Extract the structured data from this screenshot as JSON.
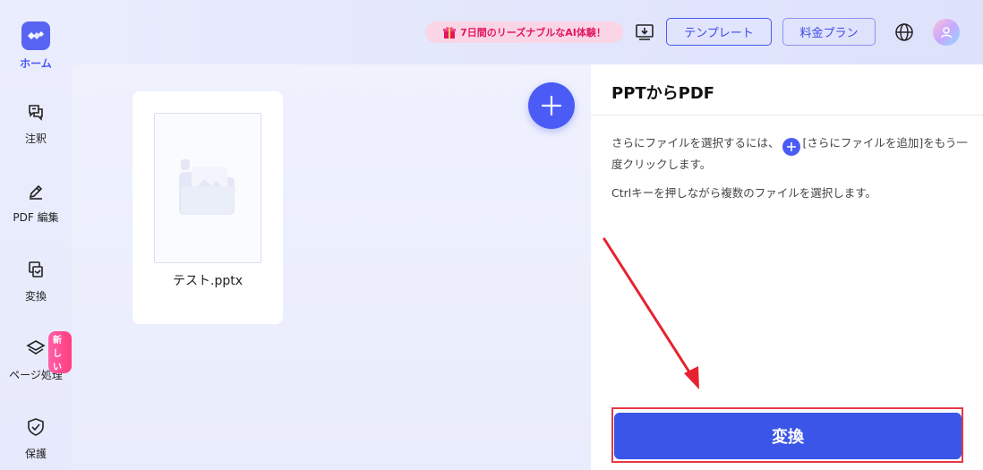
{
  "sidebar": {
    "items": [
      {
        "label": "ホーム",
        "icon": "logo-icon"
      },
      {
        "label": "注釈",
        "icon": "comment-icon"
      },
      {
        "label": "PDF 編集",
        "icon": "edit-icon"
      },
      {
        "label": "変換",
        "icon": "convert-icon"
      },
      {
        "label": "ページ処理",
        "icon": "layers-icon",
        "badge": "新しい"
      },
      {
        "label": "保護",
        "icon": "shield-icon"
      }
    ]
  },
  "header": {
    "promo": "7日間のリーズナブルなAI体験！",
    "template_label": "テンプレート",
    "plan_label": "料金プラン"
  },
  "workspace": {
    "file_name": "テスト.pptx"
  },
  "panel": {
    "title": "PPTからPDF",
    "info_part1": "さらにファイルを選択するには、",
    "info_part2": "[さらにファイルを追加]をもう一度クリックします。",
    "info2": "Ctrlキーを押しながら複数のファイルを選択します。",
    "convert_label": "変換"
  },
  "colors": {
    "accent": "#4a5cf5",
    "convert": "#3a55e8",
    "highlight": "#e53946",
    "promo_text": "#e2175a"
  }
}
